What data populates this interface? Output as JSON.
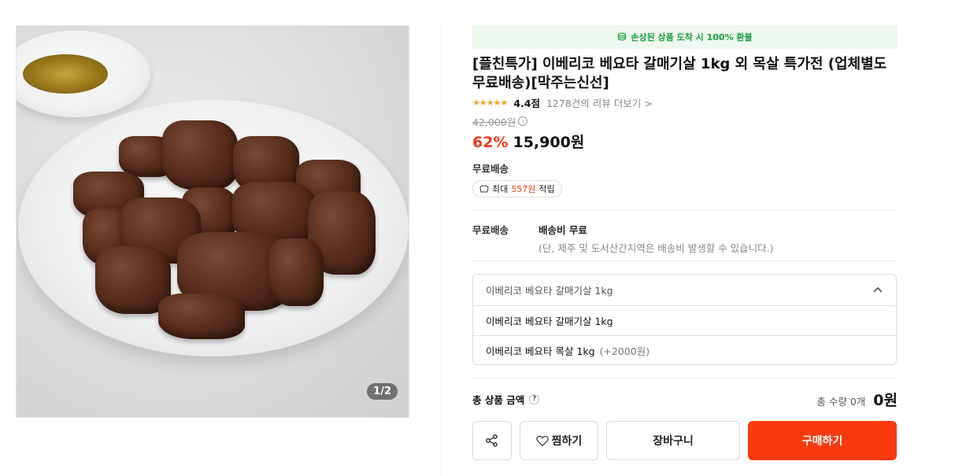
{
  "image": {
    "counter": "1/2"
  },
  "notice": {
    "text": "손상된 상품 도착 시 100% 환불"
  },
  "product": {
    "title": "[플친특가] 이베리코 베요타 갈매기살 1kg 외 목살 특가전 (업체별도 무료배송)[막주는신선]",
    "stars": "★★★★★",
    "rating": "4.4점",
    "reviews": "1278건의 리뷰 더보기 >",
    "original_price": "42,000원",
    "discount": "62%",
    "price": "15,900원",
    "shipping_label": "무료배송",
    "point": {
      "prefix": "최대 ",
      "amount": "557원",
      "suffix": " 적립"
    }
  },
  "shipping": {
    "key": "무료배송",
    "main": "배송비 무료",
    "sub": "(단, 제주 및 도서산간지역은 배송비 발생할 수 있습니다.)"
  },
  "option_select": {
    "selected": "이베리코 베요타 갈매기살 1kg",
    "options": [
      {
        "label": "이베리코 베요타 갈매기살 1kg",
        "extra": ""
      },
      {
        "label": "이베리코 베요타 목살 1kg",
        "extra": "(+2000원)"
      }
    ]
  },
  "total": {
    "label": "총 상품 금액",
    "help": "?",
    "quantity": "총 수량 0개",
    "price": "0원"
  },
  "actions": {
    "wish_label": "찜하기",
    "cart_label": "장바구니",
    "buy_label": "구매하기"
  },
  "colors": {
    "accent": "#fa3a0e",
    "discount": "#f03a17",
    "notice_bg": "#eef8ef",
    "notice_text": "#1a9e3f",
    "star": "#f5a623"
  },
  "icons": [
    "money-stack-icon",
    "info-icon",
    "coin-icon",
    "chevron-up-icon",
    "help-icon",
    "share-icon",
    "heart-icon"
  ]
}
